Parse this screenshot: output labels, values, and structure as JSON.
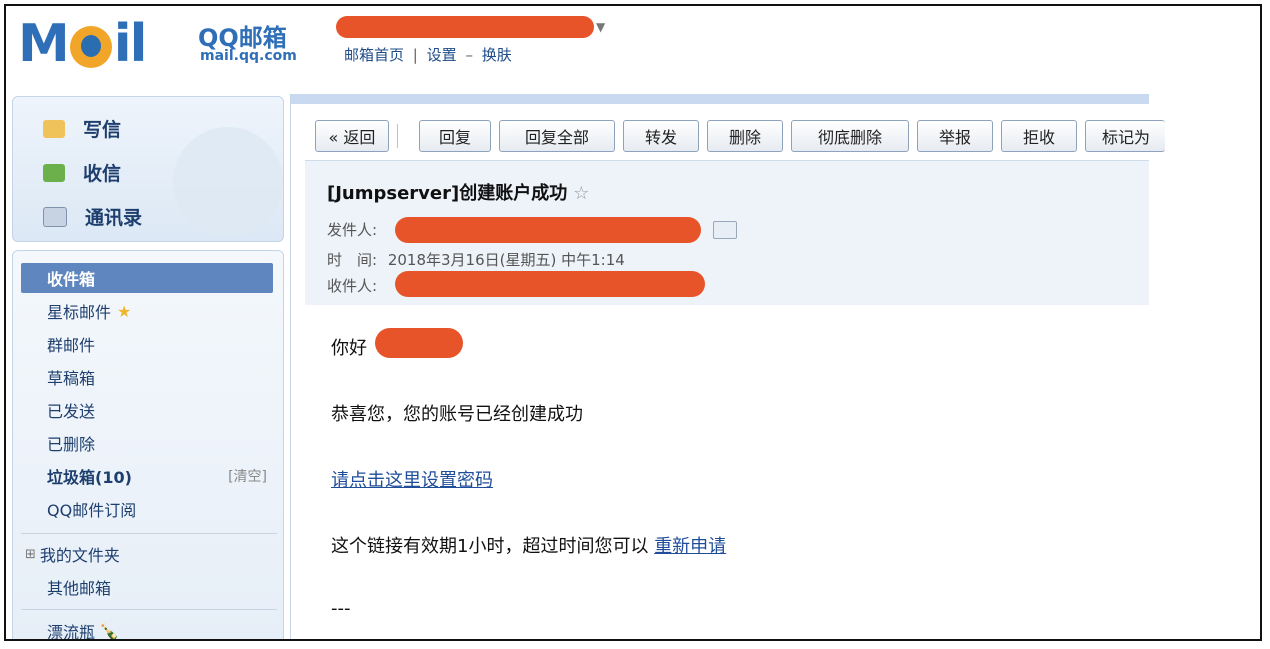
{
  "header": {
    "logo_text": "M  il",
    "brand": "QQ邮箱",
    "domain": "mail.qq.com",
    "links": [
      "邮箱首页",
      "设置",
      "换肤"
    ],
    "sep1": "|",
    "sep2": "–"
  },
  "compose": {
    "write": "写信",
    "receive": "收信",
    "contacts": "通讯录"
  },
  "folders": {
    "inbox": "收件箱",
    "starred": "星标邮件",
    "group": "群邮件",
    "drafts": "草稿箱",
    "sent": "已发送",
    "deleted": "已删除",
    "spam": "垃圾箱(10)",
    "spam_clear": "[清空]",
    "subscriptions": "QQ邮件订阅",
    "my_folders": "我的文件夹",
    "other_mailboxes": "其他邮箱",
    "drift_bottle": "漂流瓶"
  },
  "toolbar": {
    "back": "« 返回",
    "reply": "回复",
    "reply_all": "回复全部",
    "forward": "转发",
    "delete": "删除",
    "delete_forever": "彻底删除",
    "report": "举报",
    "reject": "拒收",
    "mark": "标记为"
  },
  "message": {
    "subject": "[Jumpserver]创建账户成功",
    "from_label": "发件人:",
    "time_label": "时　间:",
    "time_value": "2018年3月16日(星期五) 中午1:14",
    "to_label": "收件人:",
    "greeting": "你好",
    "line1": "恭喜您，您的账号已经创建成功",
    "link_text": "请点击这里设置密码",
    "line3_prefix": "这个链接有效期1小时，超过时间您可以 ",
    "reapply_link": "重新申请",
    "signature": "---"
  },
  "colors": {
    "redaction": "#e8542a",
    "brand_blue": "#2f6fb8",
    "active_folder": "#5f86bf"
  }
}
